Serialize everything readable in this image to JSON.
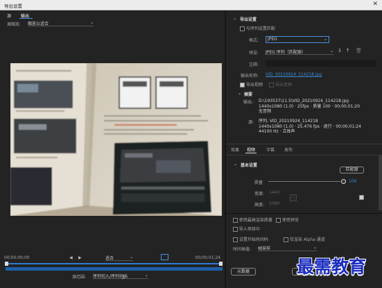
{
  "window": {
    "title": "导出设置",
    "close": "✕"
  },
  "left": {
    "tabs": [
      "源",
      "输出"
    ],
    "source_scaling_label": "源缩放:",
    "source_scaling_value": "缩放以适合",
    "timecode_start": "00;00;00;00",
    "fit_value": "适合",
    "timecode_end": "00;00;01;24",
    "range_label": "源范围:",
    "range_value": "序列切入/序列切出"
  },
  "right": {
    "export_settings_title": "导出设置",
    "match_sequence_label": "与序列设置匹配",
    "format_label": "格式:",
    "format_value": "JPEG",
    "preset_label": "预设:",
    "preset_value": "JPEG 序列（匹配源）",
    "comment_label": "注释:",
    "output_name_label": "输出名称:",
    "output_name_value": "VID_20210924_114218.jpg",
    "export_video_label": "导出视频",
    "export_audio_label": "导出音频",
    "summary_title": "摘要",
    "output_key": "输出:",
    "output_lines": [
      "D:\\193537\\11.5\\VID_20210924_114218.jpg",
      "1440x1080 (1.0) · 25fps · 质量 100 · 00;00;01;20",
      "无音频"
    ],
    "source_key": "源:",
    "source_lines": [
      "序列, VID_20210924_114218",
      "1440x1080 (1.0) · 25.476 fps · 逐行 · 00;00;01;24",
      "44100 Hz · 立体声"
    ],
    "tabs": [
      "效果",
      "视频",
      "字幕",
      "发布"
    ],
    "basic_settings_title": "基本设置",
    "match_source_button": "匹配源",
    "quality_label": "质量",
    "quality_value": "100",
    "width_label": "宽度:",
    "width_value": "1440",
    "height_label": "高度:",
    "height_value": "1080",
    "options": [
      "使用最高渲染质量",
      "使用预览",
      "导入项目中",
      "设置开始时间码",
      "仅渲染 Alpha 通道"
    ],
    "time_interp_label": "时间插值:",
    "time_interp_value": "帧采样",
    "metadata_button": "元数据",
    "queue_button": "队列"
  },
  "watermark": "最需教育"
}
